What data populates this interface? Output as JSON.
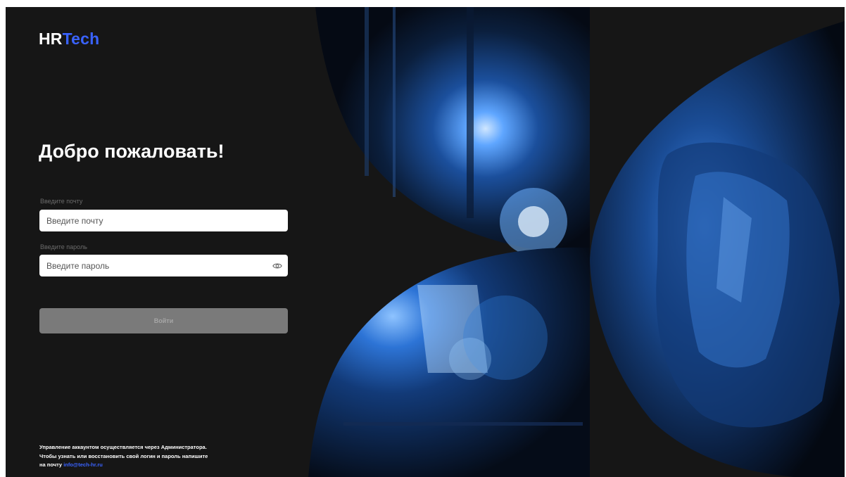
{
  "brand": {
    "part1": "HR",
    "part2": "Tech",
    "accent_color": "#3a63ff"
  },
  "heading": "Добро пожаловать!",
  "email": {
    "label": "Введите почту",
    "placeholder": "Введите почту",
    "value": ""
  },
  "password": {
    "label": "Введите пароль",
    "placeholder": "Введите пароль",
    "value": "",
    "toggle_icon": "eye-icon"
  },
  "login_button": {
    "label": "Войти",
    "state": "disabled"
  },
  "footer": {
    "line1": "Управление аккаунтом осуществляется через Администратора.",
    "line2": "Чтобы узнать или восстановить свой логин и пароль напишите",
    "line3_prefix": "на почту ",
    "email": "info@tech-hr.ru"
  },
  "hero_image": {
    "subject": "welder-photo"
  }
}
